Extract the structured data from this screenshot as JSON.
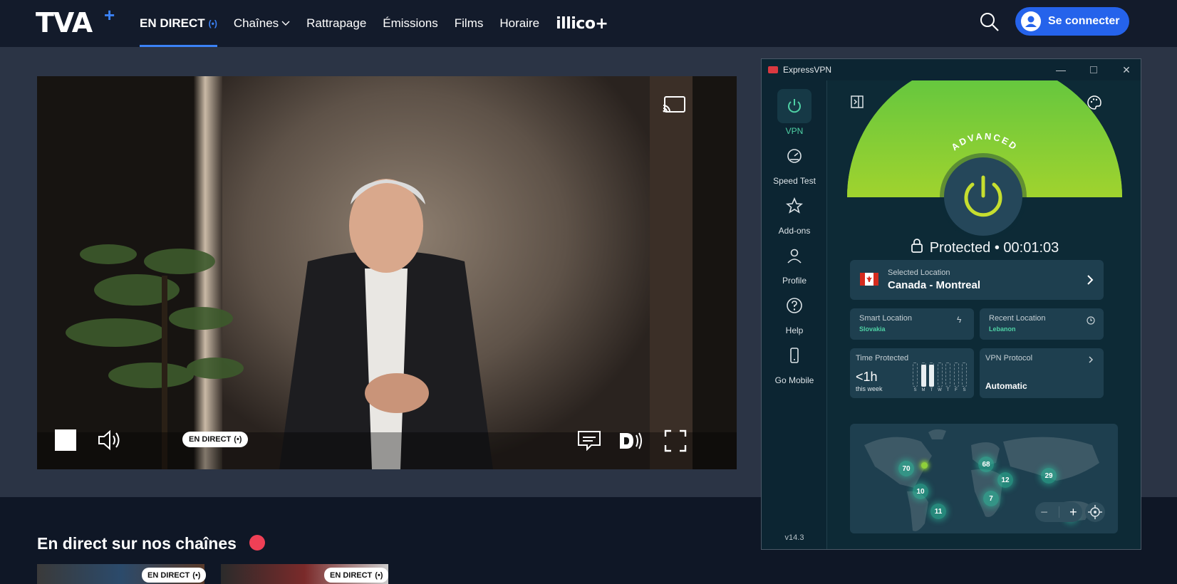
{
  "nav": {
    "logo": "TVA",
    "links": [
      {
        "label": "EN DIRECT",
        "active": true,
        "live_icon": "(•)"
      },
      {
        "label": "Chaînes",
        "chevron": "⌵"
      },
      {
        "label": "Rattrapage"
      },
      {
        "label": "Émissions"
      },
      {
        "label": "Films"
      },
      {
        "label": "Horaire"
      },
      {
        "label": "illico+"
      }
    ],
    "login": "Se connecter"
  },
  "player": {
    "live_label": "EN DIRECT",
    "live_icon": "(•)",
    "icons": [
      "cast-icon",
      "stop-icon",
      "volume-icon",
      "captions-icon",
      "audio-description-icon",
      "fullscreen-icon"
    ]
  },
  "lower": {
    "title": "En direct sur nos chaînes",
    "cards": [
      {
        "pill": "EN DIRECT",
        "icon": "(•)"
      },
      {
        "pill": "EN DIRECT",
        "icon": "(•)"
      }
    ]
  },
  "vpn": {
    "title": "ExpressVPN",
    "sidebar": [
      {
        "label": "VPN",
        "icon": "power-icon",
        "active": true
      },
      {
        "label": "Speed Test",
        "icon": "speedometer-icon"
      },
      {
        "label": "Add-ons",
        "icon": "star-icon"
      },
      {
        "label": "Profile",
        "icon": "person-icon"
      },
      {
        "label": "Help",
        "icon": "question-icon"
      },
      {
        "label": "Go Mobile",
        "icon": "phone-icon"
      }
    ],
    "version": "v14.3",
    "badge": "ADVANCED",
    "status": "Protected • 00:01:03",
    "selected": {
      "label": "Selected Location",
      "value": "Canada - Montreal"
    },
    "smart": {
      "label": "Smart Location",
      "value": "Slovakia"
    },
    "recent": {
      "label": "Recent Location",
      "value": "Lebanon"
    },
    "time": {
      "label": "Time Protected",
      "value": "<1h",
      "sub": "this week",
      "days": [
        "S",
        "M",
        "T",
        "W",
        "T",
        "F",
        "S"
      ],
      "levels": [
        0.0,
        0.9,
        0.9,
        0.0,
        0.0,
        0.0,
        0.0
      ]
    },
    "protocol": {
      "label": "VPN Protocol",
      "value": "Automatic"
    },
    "map_pins": [
      "70",
      "10",
      "11",
      "68",
      "12",
      "7",
      "29",
      "8"
    ],
    "colors": {
      "accent": "#4fd1a5",
      "green": "#61c640",
      "bg": "#0d2a36"
    }
  }
}
